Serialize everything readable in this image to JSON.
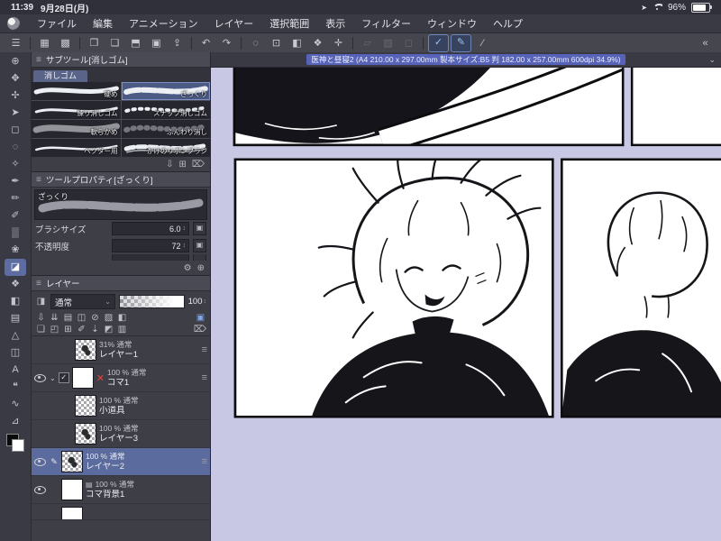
{
  "glyphs": {
    "handle": "≡",
    "chevron_down": "⌄",
    "collapse": "«",
    "check": "✓",
    "red_x": "✕",
    "pencil": "✎",
    "stepper": "↕",
    "add": "⊞",
    "import": "⇩",
    "trash": "⌦",
    "gear": "⚙",
    "zoom_plus": "⊕",
    "paper": "▤",
    "location": "➤",
    "settings_box": "▣"
  },
  "status_bar": {
    "time": "11:39",
    "date": "9月28日(月)",
    "battery_percent": "96%"
  },
  "menu_bar": {
    "items": [
      "ファイル",
      "編集",
      "アニメーション",
      "レイヤー",
      "選択範囲",
      "表示",
      "フィルター",
      "ウィンドウ",
      "ヘルプ"
    ]
  },
  "toolbar": {
    "icons": [
      {
        "name": "menu-icon",
        "glyph": "☰"
      },
      {
        "name": "workspace-icon",
        "glyph": "▦"
      },
      {
        "name": "screen-grid-icon",
        "glyph": "▩"
      },
      {
        "name": "duplicate-icon",
        "glyph": "❐"
      },
      {
        "name": "new-canvas-icon",
        "glyph": "❏"
      },
      {
        "name": "photo-import-icon",
        "glyph": "⬒"
      },
      {
        "name": "scan-icon",
        "glyph": "▣"
      },
      {
        "name": "share-icon",
        "glyph": "⇪"
      },
      {
        "name": "undo-icon",
        "glyph": "↶"
      },
      {
        "name": "redo-icon",
        "glyph": "↷"
      },
      {
        "name": "deselect-icon",
        "glyph": "◌"
      },
      {
        "name": "transform-icon",
        "glyph": "⊡"
      },
      {
        "name": "fill-select-icon",
        "glyph": "◧"
      },
      {
        "name": "material-icon",
        "glyph": "❖"
      },
      {
        "name": "crop-icon",
        "glyph": "✛"
      },
      {
        "name": "mask-disabled-icon",
        "glyph": "▱",
        "disabled": true
      },
      {
        "name": "halftone-disabled-icon",
        "glyph": "▨",
        "disabled": true
      },
      {
        "name": "frame-disabled-icon",
        "glyph": "◻",
        "disabled": true
      },
      {
        "name": "snap-check-icon",
        "glyph": "✓",
        "active": true
      },
      {
        "name": "snap-pen-icon",
        "glyph": "✎",
        "active": true
      },
      {
        "name": "line-correct-icon",
        "glyph": "∕"
      },
      {
        "name": "collapse-toolbar-icon",
        "glyph": "«"
      }
    ]
  },
  "tool_column": {
    "tools": [
      {
        "name": "zoom-tool",
        "glyph": "⊕"
      },
      {
        "name": "hand-tool",
        "glyph": "✥"
      },
      {
        "name": "move-tool",
        "glyph": "✢"
      },
      {
        "name": "operation-tool",
        "glyph": "➤"
      },
      {
        "name": "selection-tool",
        "glyph": "◻"
      },
      {
        "name": "lasso-tool",
        "glyph": "◌"
      },
      {
        "name": "eyedropper-tool",
        "glyph": "✧"
      },
      {
        "name": "pen-tool",
        "glyph": "✒"
      },
      {
        "name": "pencil-tool",
        "glyph": "✏"
      },
      {
        "name": "brush-tool",
        "glyph": "✐"
      },
      {
        "name": "airbrush-tool",
        "glyph": "▒"
      },
      {
        "name": "decoration-tool",
        "glyph": "❀"
      },
      {
        "name": "eraser-tool",
        "glyph": "◪",
        "selected": true
      },
      {
        "name": "blend-tool",
        "glyph": "❖"
      },
      {
        "name": "fill-tool",
        "glyph": "◧"
      },
      {
        "name": "gradient-tool",
        "glyph": "▤"
      },
      {
        "name": "figure-tool",
        "glyph": "△"
      },
      {
        "name": "frame-border-tool",
        "glyph": "◫"
      },
      {
        "name": "text-tool",
        "glyph": "A"
      },
      {
        "name": "balloon-tool",
        "glyph": "❝"
      },
      {
        "name": "correction-tool",
        "glyph": "∿"
      },
      {
        "name": "ruler-tool",
        "glyph": "⊿"
      }
    ]
  },
  "subtool_panel": {
    "title": "サブツール[消しゴム]",
    "tab": "消しゴム",
    "brushes": [
      {
        "label": "硬め"
      },
      {
        "label": "ざっくり",
        "selected": true
      },
      {
        "label": "練り消しゴム"
      },
      {
        "label": "スナップ消しゴム"
      },
      {
        "label": "軟らかめ"
      },
      {
        "label": "ふんわり消し"
      },
      {
        "label": "ベクター用"
      },
      {
        "label": "かけのリボンブラシ"
      }
    ]
  },
  "tool_property_panel": {
    "title": "ツールプロパティ[ざっくり]",
    "brush_name": "ざっくり",
    "params": [
      {
        "label": "ブラシサイズ",
        "value": "6.0"
      },
      {
        "label": "不透明度",
        "value": "72"
      }
    ]
  },
  "layer_panel": {
    "title": "レイヤー",
    "blend_mode": "通常",
    "opacity": "100",
    "layers": [
      {
        "badge": "31% 通常",
        "name": "レイヤー1",
        "eye": false,
        "selected": false
      },
      {
        "badge": "100 % 通常",
        "name": "コマ1",
        "eye": true,
        "selected": false,
        "folder": true
      },
      {
        "badge": "100 % 通常",
        "name": "小道具",
        "eye": false,
        "selected": false
      },
      {
        "badge": "100 % 通常",
        "name": "レイヤー3",
        "eye": false,
        "selected": false
      },
      {
        "badge": "100 % 通常",
        "name": "レイヤー2",
        "eye": true,
        "selected": true,
        "editing": true
      },
      {
        "badge": "100 % 通常",
        "name": "コマ背景1",
        "eye": true,
        "selected": false,
        "paper": true
      }
    ]
  },
  "canvas": {
    "title": "医神と昼寝2 (A4 210.00 x 297.00mm 製本サイズ:B5 判 182.00 x 257.00mm 600dpi 34.9%)"
  }
}
